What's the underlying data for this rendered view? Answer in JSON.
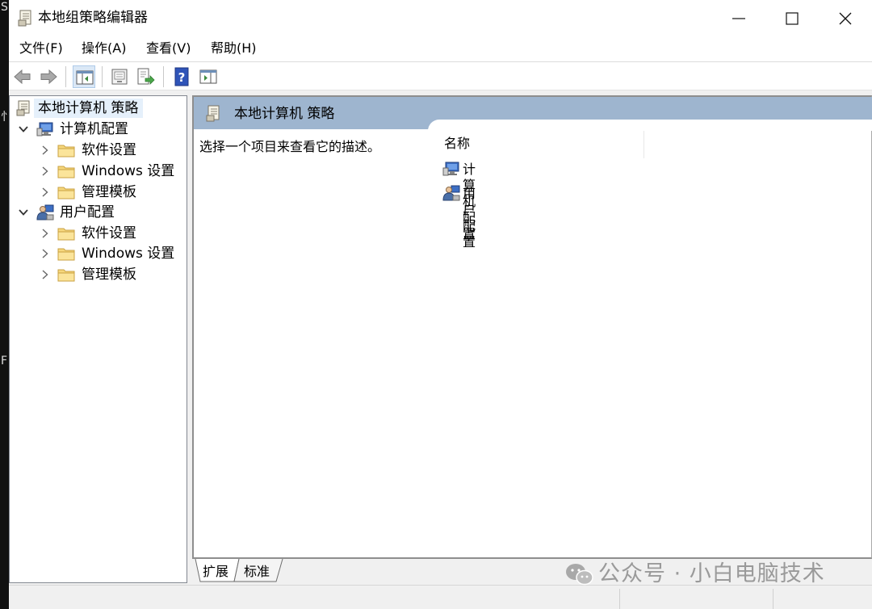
{
  "desktop": {
    "edge_glyphs": [
      "S",
      "忄",
      "F"
    ]
  },
  "window": {
    "title": "本地组策略编辑器",
    "controls": {
      "minimize": "minimize-icon",
      "maximize": "maximize-icon",
      "close": "close-icon"
    }
  },
  "menubar": {
    "items": [
      {
        "label": "文件(F)"
      },
      {
        "label": "操作(A)"
      },
      {
        "label": "查看(V)"
      },
      {
        "label": "帮助(H)"
      }
    ]
  },
  "toolbar": {
    "buttons": [
      "back-arrow-icon",
      "forward-arrow-icon",
      "show-hide-tree-icon",
      "properties-icon",
      "export-list-icon",
      "help-icon",
      "console-view-icon"
    ]
  },
  "tree": {
    "root": {
      "label": "本地计算机 策略",
      "selected": true
    },
    "nodes": [
      {
        "label": "计算机配置",
        "expanded": true,
        "children": [
          {
            "label": "软件设置"
          },
          {
            "label": "Windows 设置"
          },
          {
            "label": "管理模板"
          }
        ]
      },
      {
        "label": "用户配置",
        "expanded": true,
        "children": [
          {
            "label": "软件设置"
          },
          {
            "label": "Windows 设置"
          },
          {
            "label": "管理模板"
          }
        ]
      }
    ]
  },
  "details": {
    "banner_title": "本地计算机 策略",
    "description": "选择一个项目来查看它的描述。",
    "column_header": "名称",
    "items": [
      {
        "label": "计算机配置",
        "icon": "computer-config-icon"
      },
      {
        "label": "用户配置",
        "icon": "user-config-icon"
      }
    ]
  },
  "tabs": [
    {
      "label": "扩展",
      "active": true
    },
    {
      "label": "标准",
      "active": false
    }
  ],
  "watermark": {
    "text": "公众号 · 小白电脑技术"
  },
  "colors": {
    "banner": "#9eb5cf",
    "selection": "#e5f0fb",
    "folder": "#f6d77c",
    "toolbar_active": "#dbe8f6"
  }
}
